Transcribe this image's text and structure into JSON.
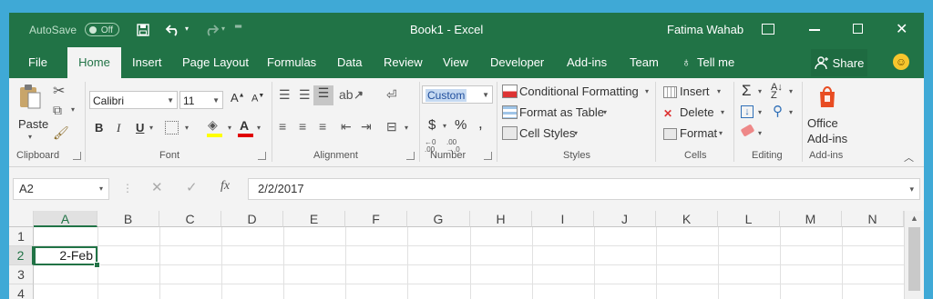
{
  "titlebar": {
    "autosave_label": "AutoSave",
    "autosave_state": "Off",
    "save_icon": "save-icon",
    "undo_icon": "undo-icon",
    "redo_icon": "redo-icon",
    "customize_icon": "customize-qat-icon",
    "document_title": "Book1  -  Excel",
    "user_name": "Fatima Wahab"
  },
  "tabs": [
    "File",
    "Home",
    "Insert",
    "Page Layout",
    "Formulas",
    "Data",
    "Review",
    "View",
    "Developer",
    "Add-ins",
    "Team"
  ],
  "tell_me": "Tell me",
  "share_label": "Share",
  "ribbon": {
    "clipboard": {
      "paste_label": "Paste",
      "group_label": "Clipboard"
    },
    "font": {
      "font_name": "Calibri",
      "font_size": "11",
      "bold": "B",
      "italic": "I",
      "underline": "U",
      "group_label": "Font"
    },
    "alignment": {
      "group_label": "Alignment"
    },
    "number": {
      "format": "Custom",
      "currency": "$",
      "percent": "%",
      "comma": ",",
      "group_label": "Number"
    },
    "styles": {
      "conditional_formatting": "Conditional Formatting",
      "format_as_table": "Format as Table",
      "cell_styles": "Cell Styles",
      "group_label": "Styles"
    },
    "cells": {
      "insert": "Insert",
      "delete": "Delete",
      "format": "Format",
      "group_label": "Cells"
    },
    "editing": {
      "group_label": "Editing"
    },
    "addins": {
      "office_addins_line1": "Office",
      "office_addins_line2": "Add-ins",
      "group_label": "Add-ins"
    }
  },
  "formula_bar": {
    "name_box": "A2",
    "fx": "fx",
    "formula": "2/2/2017"
  },
  "grid": {
    "columns": [
      "A",
      "B",
      "C",
      "D",
      "E",
      "F",
      "G",
      "H",
      "I",
      "J",
      "K",
      "L",
      "M",
      "N"
    ],
    "rows": [
      "1",
      "2",
      "3",
      "4"
    ],
    "selected_cell_value": "2-Feb"
  },
  "colors": {
    "excel_green": "#217346",
    "desktop_blue": "#3fa9d6"
  }
}
